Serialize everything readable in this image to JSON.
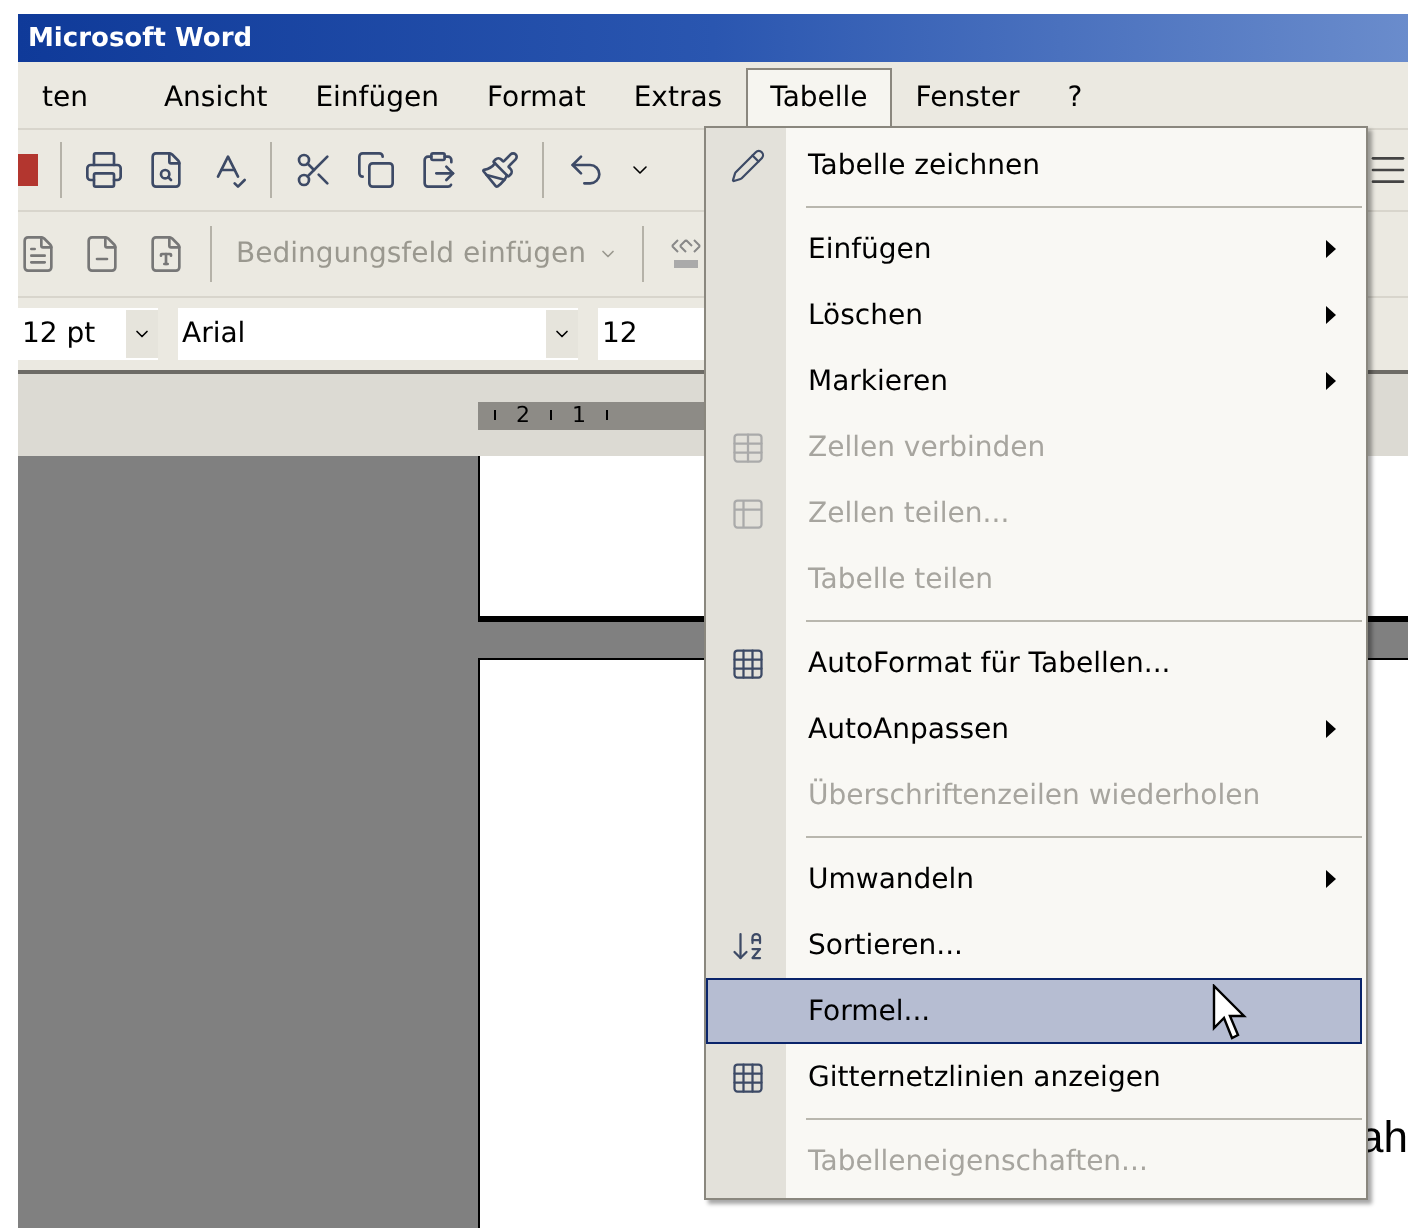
{
  "window": {
    "title": "Microsoft Word"
  },
  "menu_bar": [
    {
      "label": "ten",
      "selected": false
    },
    {
      "label": "Ansicht",
      "selected": false
    },
    {
      "label": "Einfügen",
      "selected": false
    },
    {
      "label": "Format",
      "selected": false
    },
    {
      "label": "Extras",
      "selected": false
    },
    {
      "label": "Tabelle",
      "selected": true
    },
    {
      "label": "Fenster",
      "selected": false
    },
    {
      "label": "?",
      "selected": false
    }
  ],
  "toolbar_field": {
    "label": "Bedingungsfeld einfügen",
    "disabled": true
  },
  "formatting": {
    "style": "12 pt",
    "font": "Arial",
    "size": "12"
  },
  "ruler": {
    "labels": [
      "2",
      "1"
    ]
  },
  "menu": {
    "items": [
      {
        "kind": "item",
        "label": "Tabelle zeichnen",
        "disabled": false,
        "submenu": false,
        "selected": false
      },
      {
        "kind": "separator"
      },
      {
        "kind": "item",
        "label": "Einfügen",
        "disabled": false,
        "submenu": true,
        "selected": false
      },
      {
        "kind": "item",
        "label": "Löschen",
        "disabled": false,
        "submenu": true,
        "selected": false
      },
      {
        "kind": "item",
        "label": "Markieren",
        "disabled": false,
        "submenu": true,
        "selected": false
      },
      {
        "kind": "item",
        "label": "Zellen verbinden",
        "disabled": true,
        "submenu": false,
        "selected": false
      },
      {
        "kind": "item",
        "label": "Zellen teilen...",
        "disabled": true,
        "submenu": false,
        "selected": false
      },
      {
        "kind": "item",
        "label": "Tabelle teilen",
        "disabled": true,
        "submenu": false,
        "selected": false
      },
      {
        "kind": "separator"
      },
      {
        "kind": "item",
        "label": "AutoFormat für Tabellen...",
        "disabled": false,
        "submenu": false,
        "selected": false
      },
      {
        "kind": "item",
        "label": "AutoAnpassen",
        "disabled": false,
        "submenu": true,
        "selected": false
      },
      {
        "kind": "item",
        "label": "Überschriftenzeilen wiederholen",
        "disabled": true,
        "submenu": false,
        "selected": false
      },
      {
        "kind": "separator"
      },
      {
        "kind": "item",
        "label": "Umwandeln",
        "disabled": false,
        "submenu": true,
        "selected": false
      },
      {
        "kind": "item",
        "label": "Sortieren...",
        "disabled": false,
        "submenu": false,
        "selected": false
      },
      {
        "kind": "item",
        "label": "Formel...",
        "disabled": false,
        "submenu": false,
        "selected": true
      },
      {
        "kind": "item",
        "label": "Gitternetzlinien anzeigen",
        "disabled": false,
        "submenu": false,
        "selected": false
      },
      {
        "kind": "separator"
      },
      {
        "kind": "item",
        "label": "Tabelleneigenschaften...",
        "disabled": true,
        "submenu": false,
        "selected": false
      }
    ]
  },
  "document": {
    "text": "ah"
  }
}
